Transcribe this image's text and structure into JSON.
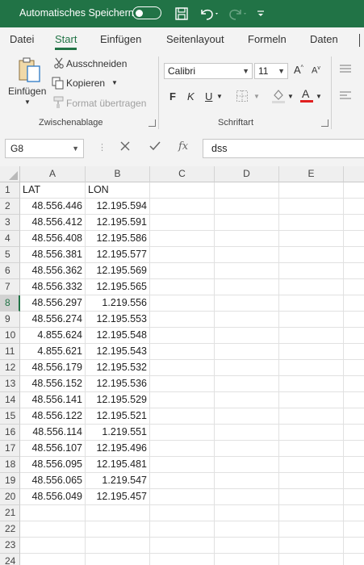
{
  "titlebar": {
    "autosave_label": "Automatisches Speichern",
    "background": "#217346"
  },
  "tabs": [
    "Datei",
    "Start",
    "Einfügen",
    "Seitenlayout",
    "Formeln",
    "Daten"
  ],
  "active_tab": "Start",
  "ribbon": {
    "clipboard": {
      "paste": "Einfügen",
      "cut": "Ausschneiden",
      "copy": "Kopieren",
      "format_painter": "Format übertragen",
      "group_label": "Zwischenablage"
    },
    "font": {
      "font_name": "Calibri",
      "font_size": "11",
      "bold": "F",
      "italic": "K",
      "underline": "U",
      "group_label": "Schriftart"
    }
  },
  "formula_bar": {
    "name_box": "G8",
    "fx": "fx",
    "content": "dss"
  },
  "grid": {
    "columns": [
      "A",
      "B",
      "C",
      "D",
      "E"
    ],
    "selected_row": 8,
    "rows": [
      {
        "n": "1",
        "a": "LAT",
        "b": "LON"
      },
      {
        "n": "2",
        "a": "48.556.446",
        "b": "12.195.594"
      },
      {
        "n": "3",
        "a": "48.556.412",
        "b": "12.195.591"
      },
      {
        "n": "4",
        "a": "48.556.408",
        "b": "12.195.586"
      },
      {
        "n": "5",
        "a": "48.556.381",
        "b": "12.195.577"
      },
      {
        "n": "6",
        "a": "48.556.362",
        "b": "12.195.569"
      },
      {
        "n": "7",
        "a": "48.556.332",
        "b": "12.195.565"
      },
      {
        "n": "8",
        "a": "48.556.297",
        "b": "1.219.556"
      },
      {
        "n": "9",
        "a": "48.556.274",
        "b": "12.195.553"
      },
      {
        "n": "10",
        "a": "4.855.624",
        "b": "12.195.548"
      },
      {
        "n": "11",
        "a": "4.855.621",
        "b": "12.195.543"
      },
      {
        "n": "12",
        "a": "48.556.179",
        "b": "12.195.532"
      },
      {
        "n": "13",
        "a": "48.556.152",
        "b": "12.195.536"
      },
      {
        "n": "14",
        "a": "48.556.141",
        "b": "12.195.529"
      },
      {
        "n": "15",
        "a": "48.556.122",
        "b": "12.195.521"
      },
      {
        "n": "16",
        "a": "48.556.114",
        "b": "1.219.551"
      },
      {
        "n": "17",
        "a": "48.556.107",
        "b": "12.195.496"
      },
      {
        "n": "18",
        "a": "48.556.095",
        "b": "12.195.481"
      },
      {
        "n": "19",
        "a": "48.556.065",
        "b": "1.219.547"
      },
      {
        "n": "20",
        "a": "48.556.049",
        "b": "12.195.457"
      },
      {
        "n": "21",
        "a": "",
        "b": ""
      },
      {
        "n": "22",
        "a": "",
        "b": ""
      },
      {
        "n": "23",
        "a": "",
        "b": ""
      },
      {
        "n": "24",
        "a": "",
        "b": ""
      }
    ]
  }
}
